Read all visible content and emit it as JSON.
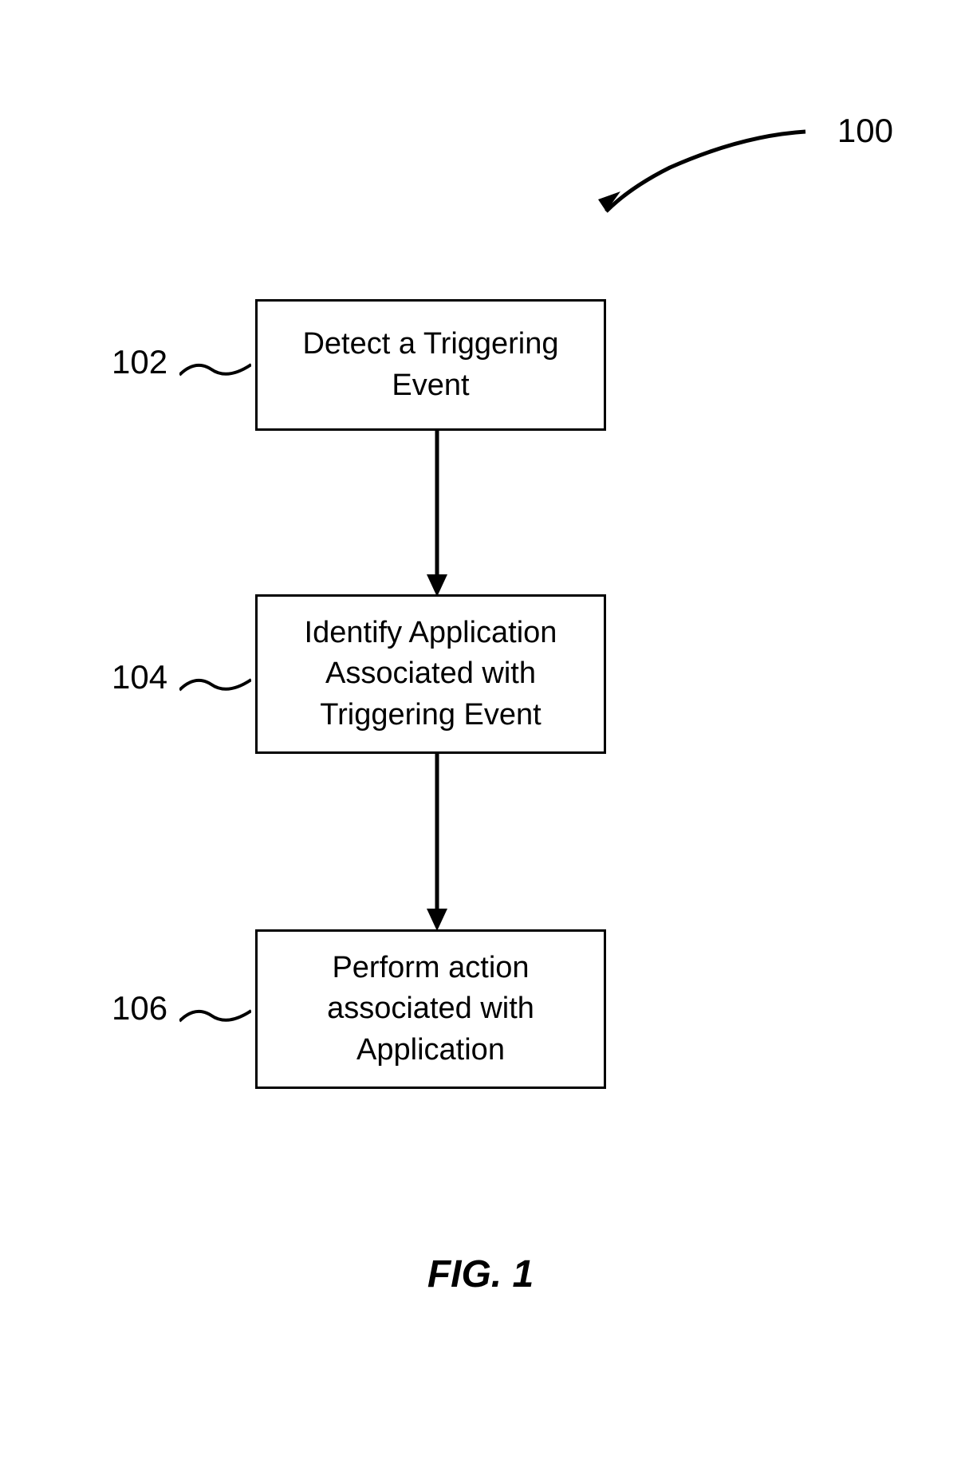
{
  "figure": {
    "label": "FIG. 1",
    "reference_number": "100"
  },
  "steps": [
    {
      "number": "102",
      "text": "Detect a Triggering Event"
    },
    {
      "number": "104",
      "text": "Identify Application Associated with Triggering Event"
    },
    {
      "number": "106",
      "text": "Perform action associated with Application"
    }
  ]
}
